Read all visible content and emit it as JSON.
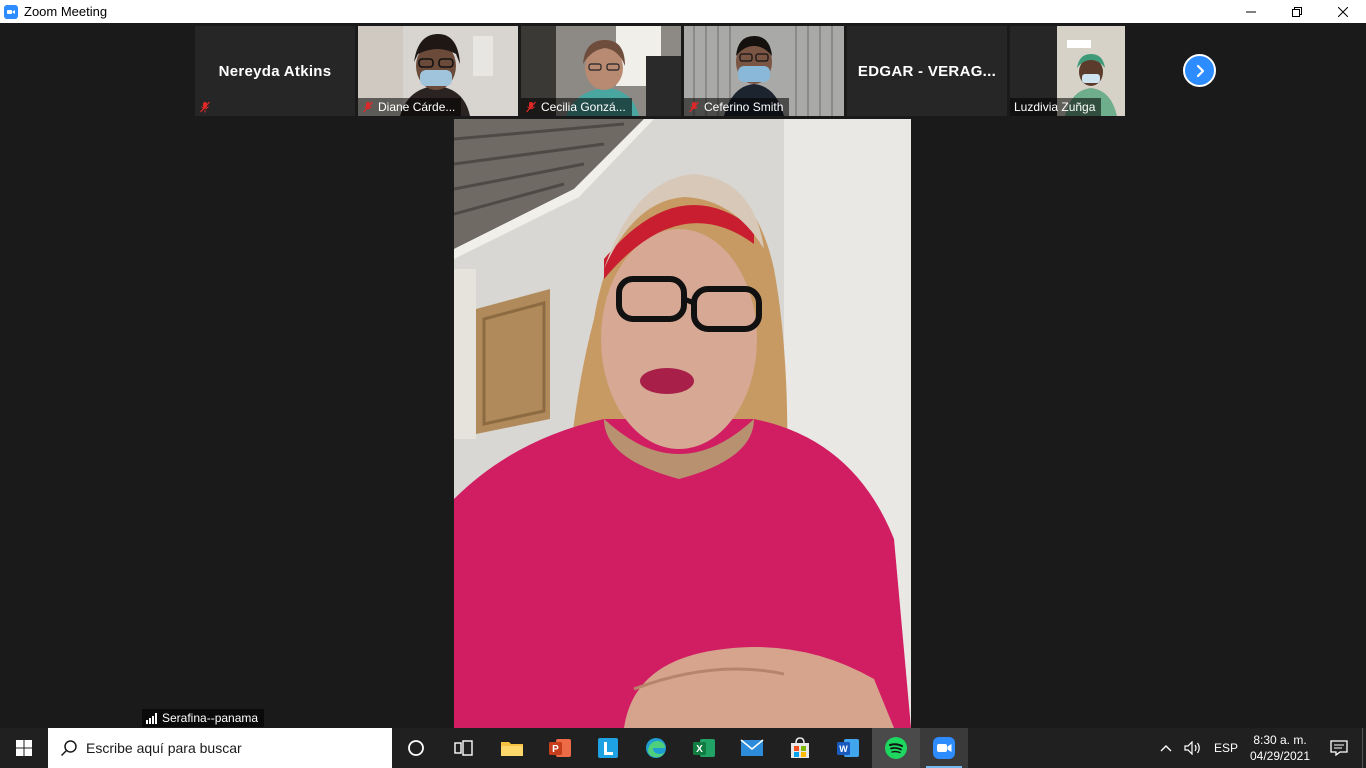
{
  "window": {
    "title": "Zoom Meeting"
  },
  "participants": [
    {
      "name": "Nereyda Atkins",
      "video": false
    },
    {
      "name": "Diane Cárde...",
      "video": true
    },
    {
      "name": "Cecilia Gonzá...",
      "video": true
    },
    {
      "name": "Ceferino Smith",
      "video": true
    },
    {
      "name": "EDGAR - VERAG...",
      "video": false
    },
    {
      "name": "Luzdivia Zuñga",
      "video": true
    }
  ],
  "speaker": {
    "name": "Serafina--panama"
  },
  "taskbar": {
    "search_placeholder": "Escribe aquí para buscar",
    "language": "ESP",
    "time": "8:30 a. m.",
    "date": "04/29/2021",
    "pinned": [
      "Cortana",
      "Task View",
      "File Explorer",
      "PowerPoint",
      "Lens",
      "Edge",
      "Excel",
      "Mail",
      "Microsoft Store",
      "Word",
      "Spotify",
      "Zoom"
    ]
  },
  "colors": {
    "zoom_blue": "#2d8cff",
    "background": "#1a1a1a",
    "tile_bg": "#262626",
    "mute_red": "#e02828"
  }
}
